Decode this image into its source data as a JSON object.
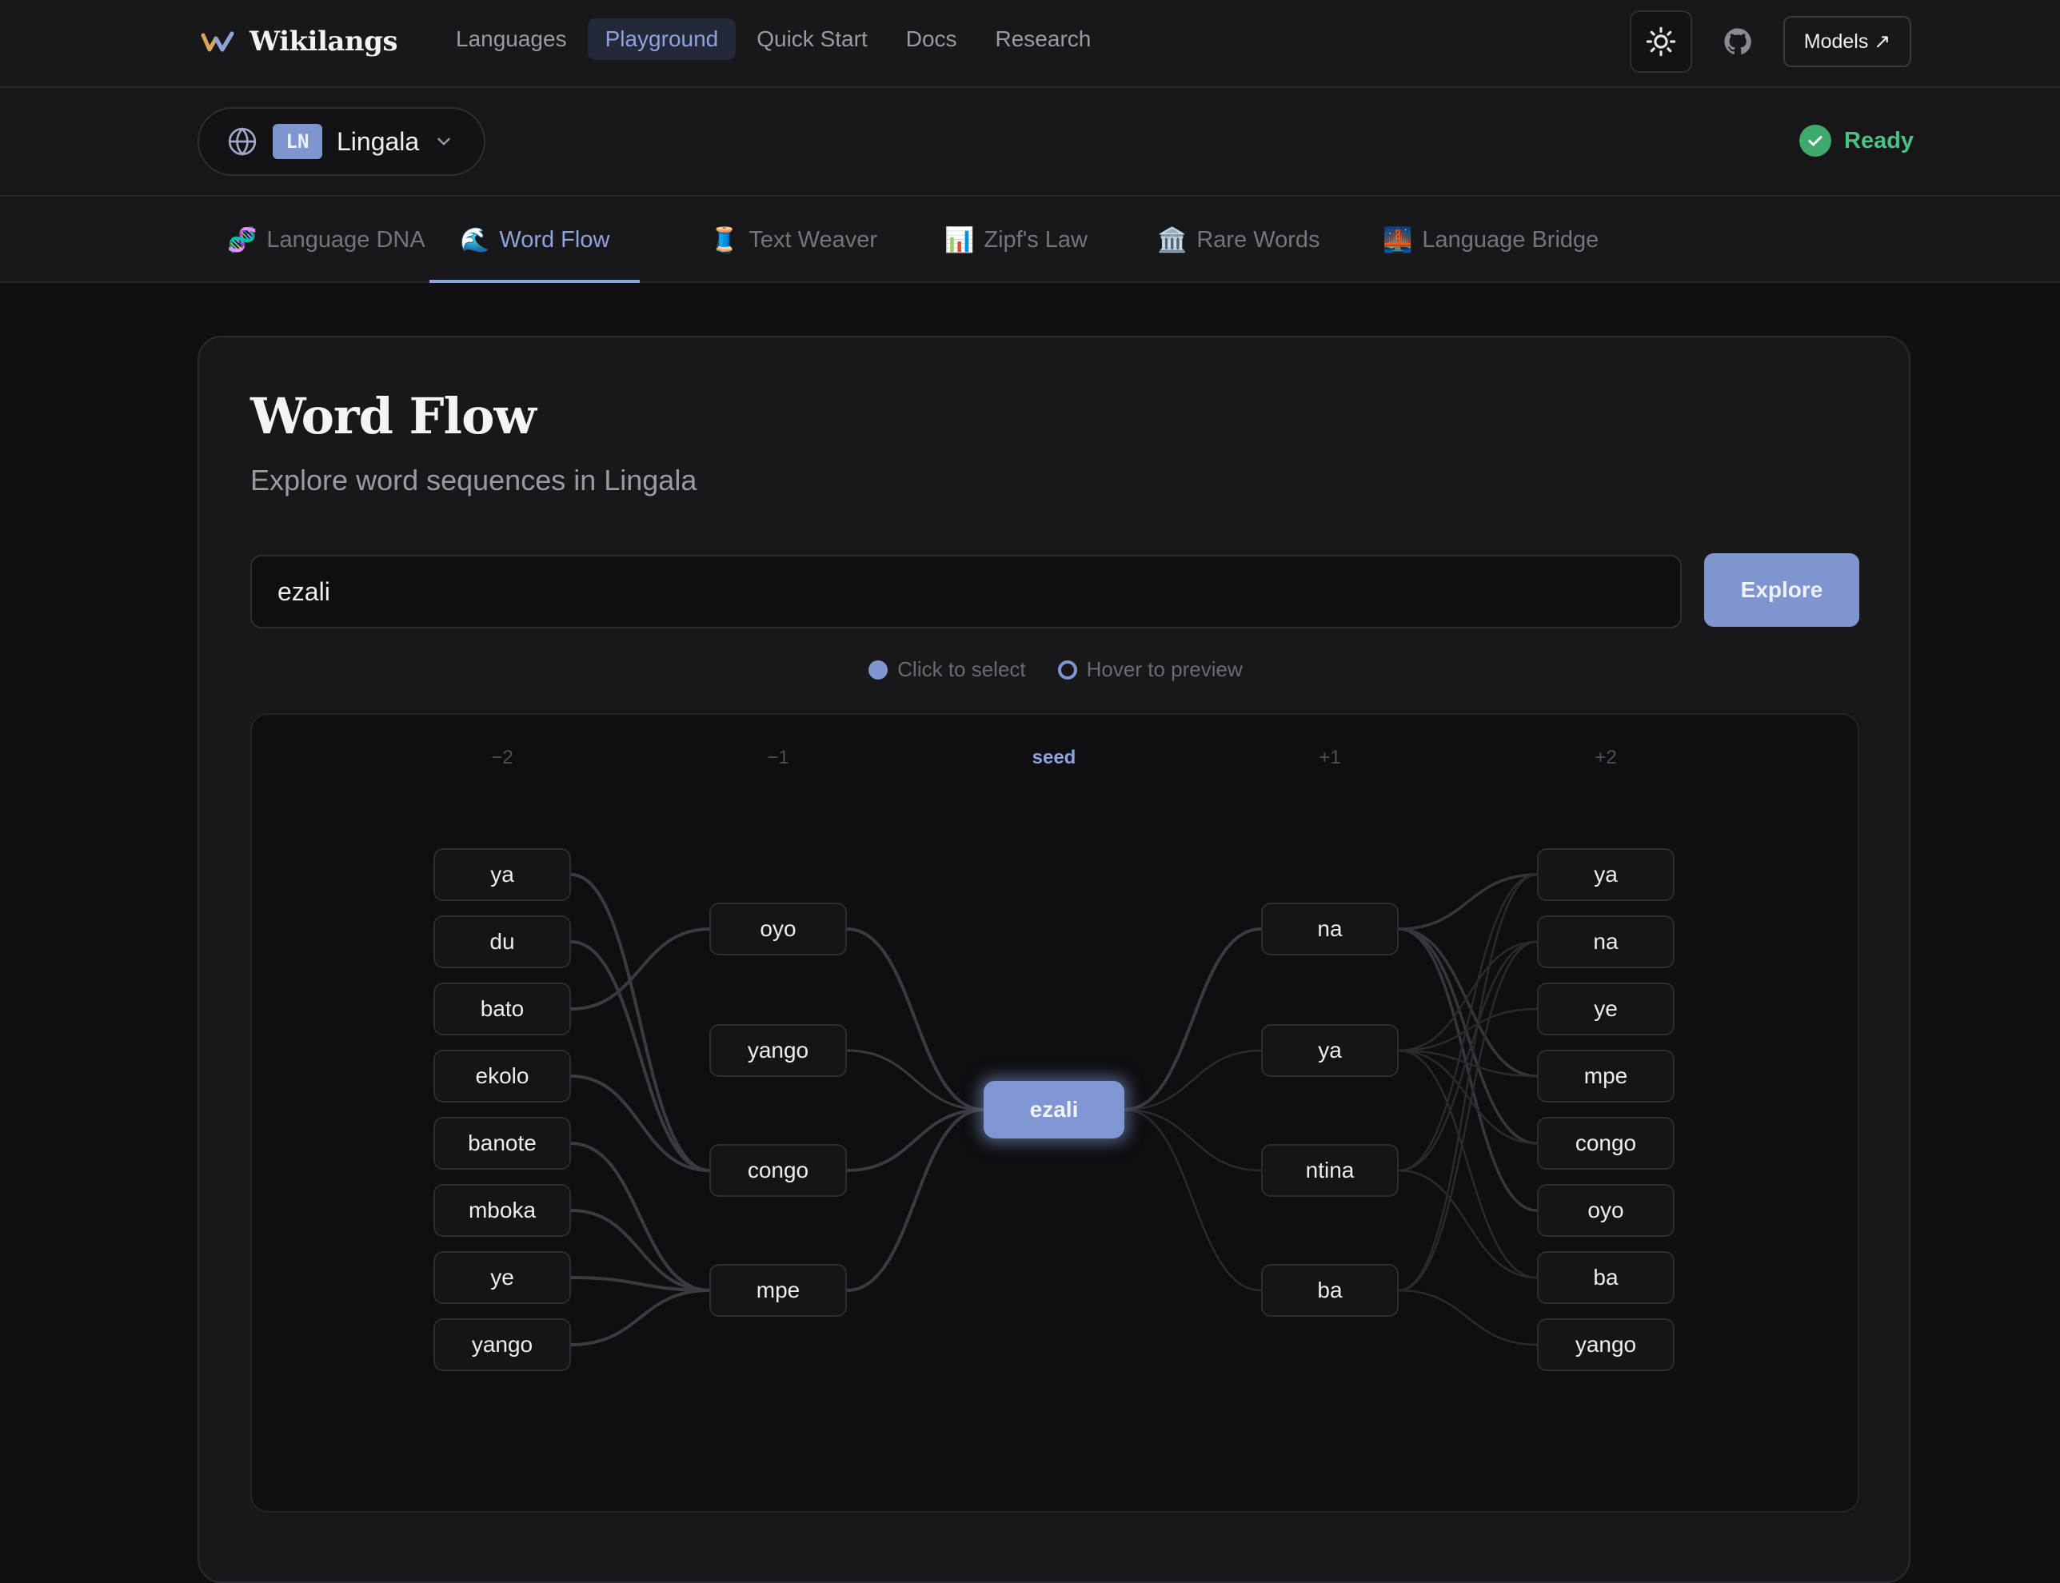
{
  "brand": {
    "name": "Wikilangs"
  },
  "nav": {
    "links": [
      "Languages",
      "Playground",
      "Quick Start",
      "Docs",
      "Research"
    ],
    "active": 1,
    "models_label": "Models ↗"
  },
  "language": {
    "code": "LN",
    "name": "Lingala"
  },
  "status": {
    "text": "Ready"
  },
  "tabs": [
    {
      "emoji": "🧬",
      "label": "Language DNA"
    },
    {
      "emoji": "🌊",
      "label": "Word Flow"
    },
    {
      "emoji": "🧵",
      "label": "Text Weaver"
    },
    {
      "emoji": "📊",
      "label": "Zipf's Law"
    },
    {
      "emoji": "🏛️",
      "label": "Rare Words"
    },
    {
      "emoji": "🌉",
      "label": "Language Bridge"
    }
  ],
  "active_tab": 1,
  "panel": {
    "title": "Word Flow",
    "subtitle": "Explore word sequences in Lingala",
    "search_value": "ezali",
    "explore_label": "Explore",
    "legend": {
      "select": "Click to select",
      "hover": "Hover to preview"
    }
  },
  "graph": {
    "columns": [
      "−2",
      "−1",
      "seed",
      "+1",
      "+2"
    ],
    "seed": "ezali",
    "minus2": [
      "ya",
      "du",
      "bato",
      "ekolo",
      "banote",
      "mboka",
      "ye",
      "yango"
    ],
    "minus1": [
      "oyo",
      "yango",
      "congo",
      "mpe"
    ],
    "plus1": [
      "na",
      "ya",
      "ntina",
      "ba"
    ],
    "plus2": [
      "ya",
      "na",
      "ye",
      "mpe",
      "congo",
      "oyo",
      "ba",
      "yango"
    ],
    "edges_left": [
      [
        0,
        2
      ],
      [
        1,
        2
      ],
      [
        2,
        0
      ],
      [
        3,
        2
      ],
      [
        4,
        3
      ],
      [
        5,
        3
      ],
      [
        6,
        3
      ],
      [
        7,
        3
      ]
    ],
    "edges_right": [
      [
        0,
        0
      ],
      [
        0,
        3
      ],
      [
        0,
        4
      ],
      [
        0,
        5
      ],
      [
        1,
        1
      ],
      [
        1,
        2
      ],
      [
        1,
        3
      ],
      [
        1,
        4
      ],
      [
        1,
        6
      ],
      [
        2,
        0
      ],
      [
        2,
        1
      ],
      [
        2,
        6
      ],
      [
        3,
        0
      ],
      [
        3,
        1
      ],
      [
        3,
        7
      ]
    ],
    "edges_left_strong": [
      0,
      2,
      3,
      4
    ],
    "edges_right_strong": [
      0,
      1,
      2,
      3
    ],
    "edges_right_visible": [
      true,
      true,
      true,
      true
    ]
  },
  "icons": {
    "theme": "sun-icon",
    "github": "github-icon",
    "globe": "globe-icon",
    "chevron": "chevron-down-icon",
    "check": "check-icon"
  },
  "colors": {
    "accent": "#7e95cf",
    "success": "#3fa96b",
    "background": "#101013"
  }
}
